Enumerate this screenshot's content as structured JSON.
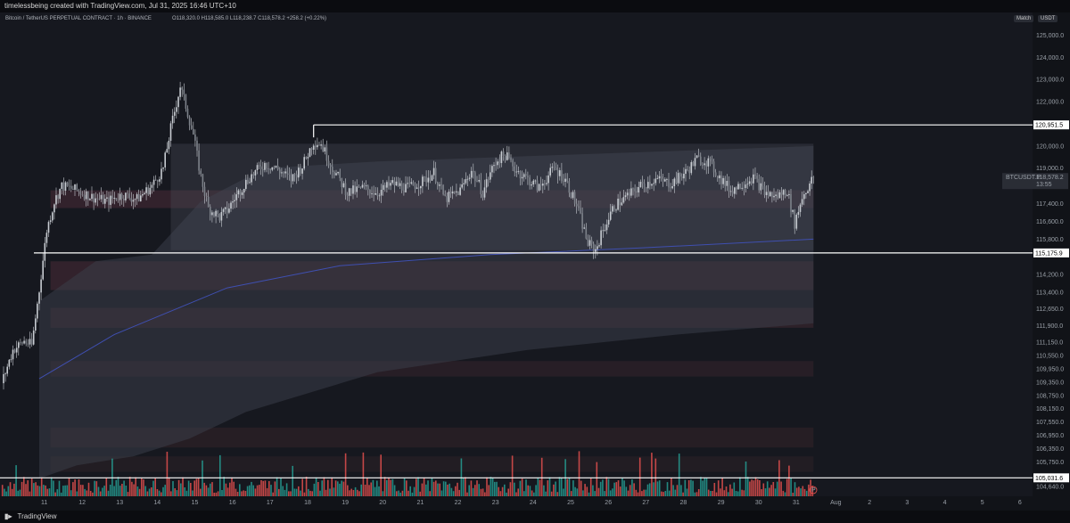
{
  "topbar": {
    "credit": "timelessbeing created with TradingView.com, Jul 31, 2025 16:46 UTC+10"
  },
  "header": {
    "symbol_line": "Bitcoin / TetherUS PERPETUAL CONTRACT · 1h · BINANCE",
    "ohlc": "O118,320.0  H118,585.0  L118,238.7  C118,578.2  +258.2 (+0.22%)"
  },
  "buttons": {
    "match": "Match",
    "currency": "USDT"
  },
  "bottombar": {
    "brand": "TradingView"
  },
  "colors": {
    "bg": "#16181f",
    "candle": "#c8ccd2",
    "volume_up": "#26a69a",
    "volume_down": "#ef5350",
    "label_bg": "#ffffff",
    "vwap": "#3f4fb0"
  },
  "chart_data": {
    "type": "candlestick",
    "x_ticks": [
      "11",
      "12",
      "13",
      "14",
      "15",
      "16",
      "17",
      "18",
      "19",
      "20",
      "21",
      "22",
      "23",
      "24",
      "25",
      "26",
      "27",
      "28",
      "29",
      "30",
      "31",
      "Aug",
      "2",
      "3",
      "4",
      "5",
      "6"
    ],
    "y_ticks": [
      "125,000.0",
      "124,000.0",
      "123,000.0",
      "122,000.0",
      "120,000.0",
      "119,000.0",
      "117,400.0",
      "116,600.0",
      "115,800.0",
      "114,200.0",
      "113,400.0",
      "112,650.0",
      "111,900.0",
      "111,150.0",
      "110,550.0",
      "109,950.0",
      "109,350.0",
      "108,750.0",
      "108,150.0",
      "107,550.0",
      "106,950.0",
      "106,350.0",
      "105,750.0",
      "104,640.0"
    ],
    "ylim": [
      104200,
      125500
    ],
    "price_path": [
      [
        10.0,
        109300
      ],
      [
        10.3,
        110800
      ],
      [
        10.6,
        111200
      ],
      [
        10.8,
        111000
      ],
      [
        11.0,
        113500
      ],
      [
        11.2,
        116200
      ],
      [
        11.4,
        117500
      ],
      [
        11.6,
        118200
      ],
      [
        12.0,
        118000
      ],
      [
        12.4,
        117700
      ],
      [
        12.8,
        117500
      ],
      [
        13.2,
        117800
      ],
      [
        13.6,
        117600
      ],
      [
        14.0,
        118200
      ],
      [
        14.3,
        119000
      ],
      [
        14.5,
        120800
      ],
      [
        14.75,
        122700
      ],
      [
        14.9,
        121800
      ],
      [
        15.1,
        120500
      ],
      [
        15.3,
        118600
      ],
      [
        15.5,
        117200
      ],
      [
        15.8,
        116800
      ],
      [
        16.0,
        117100
      ],
      [
        16.3,
        117900
      ],
      [
        16.6,
        118600
      ],
      [
        17.0,
        119200
      ],
      [
        17.3,
        119000
      ],
      [
        17.7,
        118500
      ],
      [
        18.0,
        119100
      ],
      [
        18.3,
        120200
      ],
      [
        18.5,
        120100
      ],
      [
        18.8,
        119000
      ],
      [
        19.2,
        117900
      ],
      [
        19.6,
        118100
      ],
      [
        20.0,
        117900
      ],
      [
        20.4,
        118300
      ],
      [
        20.8,
        118100
      ],
      [
        21.2,
        118400
      ],
      [
        21.5,
        118800
      ],
      [
        21.8,
        117600
      ],
      [
        22.2,
        118000
      ],
      [
        22.5,
        118900
      ],
      [
        22.8,
        117900
      ],
      [
        23.0,
        118800
      ],
      [
        23.2,
        119400
      ],
      [
        23.4,
        119600
      ],
      [
        23.7,
        118900
      ],
      [
        24.0,
        118500
      ],
      [
        24.3,
        118100
      ],
      [
        24.7,
        119000
      ],
      [
        25.0,
        118500
      ],
      [
        25.3,
        117300
      ],
      [
        25.6,
        115600
      ],
      [
        25.8,
        115300
      ],
      [
        26.0,
        116200
      ],
      [
        26.3,
        117300
      ],
      [
        26.7,
        117800
      ],
      [
        27.0,
        118200
      ],
      [
        27.4,
        118500
      ],
      [
        27.8,
        118300
      ],
      [
        28.2,
        118800
      ],
      [
        28.5,
        119400
      ],
      [
        28.8,
        119300
      ],
      [
        29.1,
        118600
      ],
      [
        29.4,
        118000
      ],
      [
        29.7,
        118300
      ],
      [
        30.0,
        118600
      ],
      [
        30.3,
        117900
      ],
      [
        30.6,
        117700
      ],
      [
        30.9,
        118000
      ],
      [
        31.1,
        116500
      ],
      [
        31.3,
        117700
      ],
      [
        31.6,
        118578
      ]
    ],
    "levels": [
      {
        "price": 120951.5,
        "label": "120,951.5"
      },
      {
        "price": 115175.9,
        "label": "115,175.9"
      },
      {
        "price": 105031.6,
        "label": "105,031.6"
      }
    ],
    "last_price": {
      "symbol": "BTCUSDT.P",
      "price": "118,578.2",
      "countdown": "13:55"
    },
    "annotations": {
      "volume_marker": "P"
    }
  }
}
